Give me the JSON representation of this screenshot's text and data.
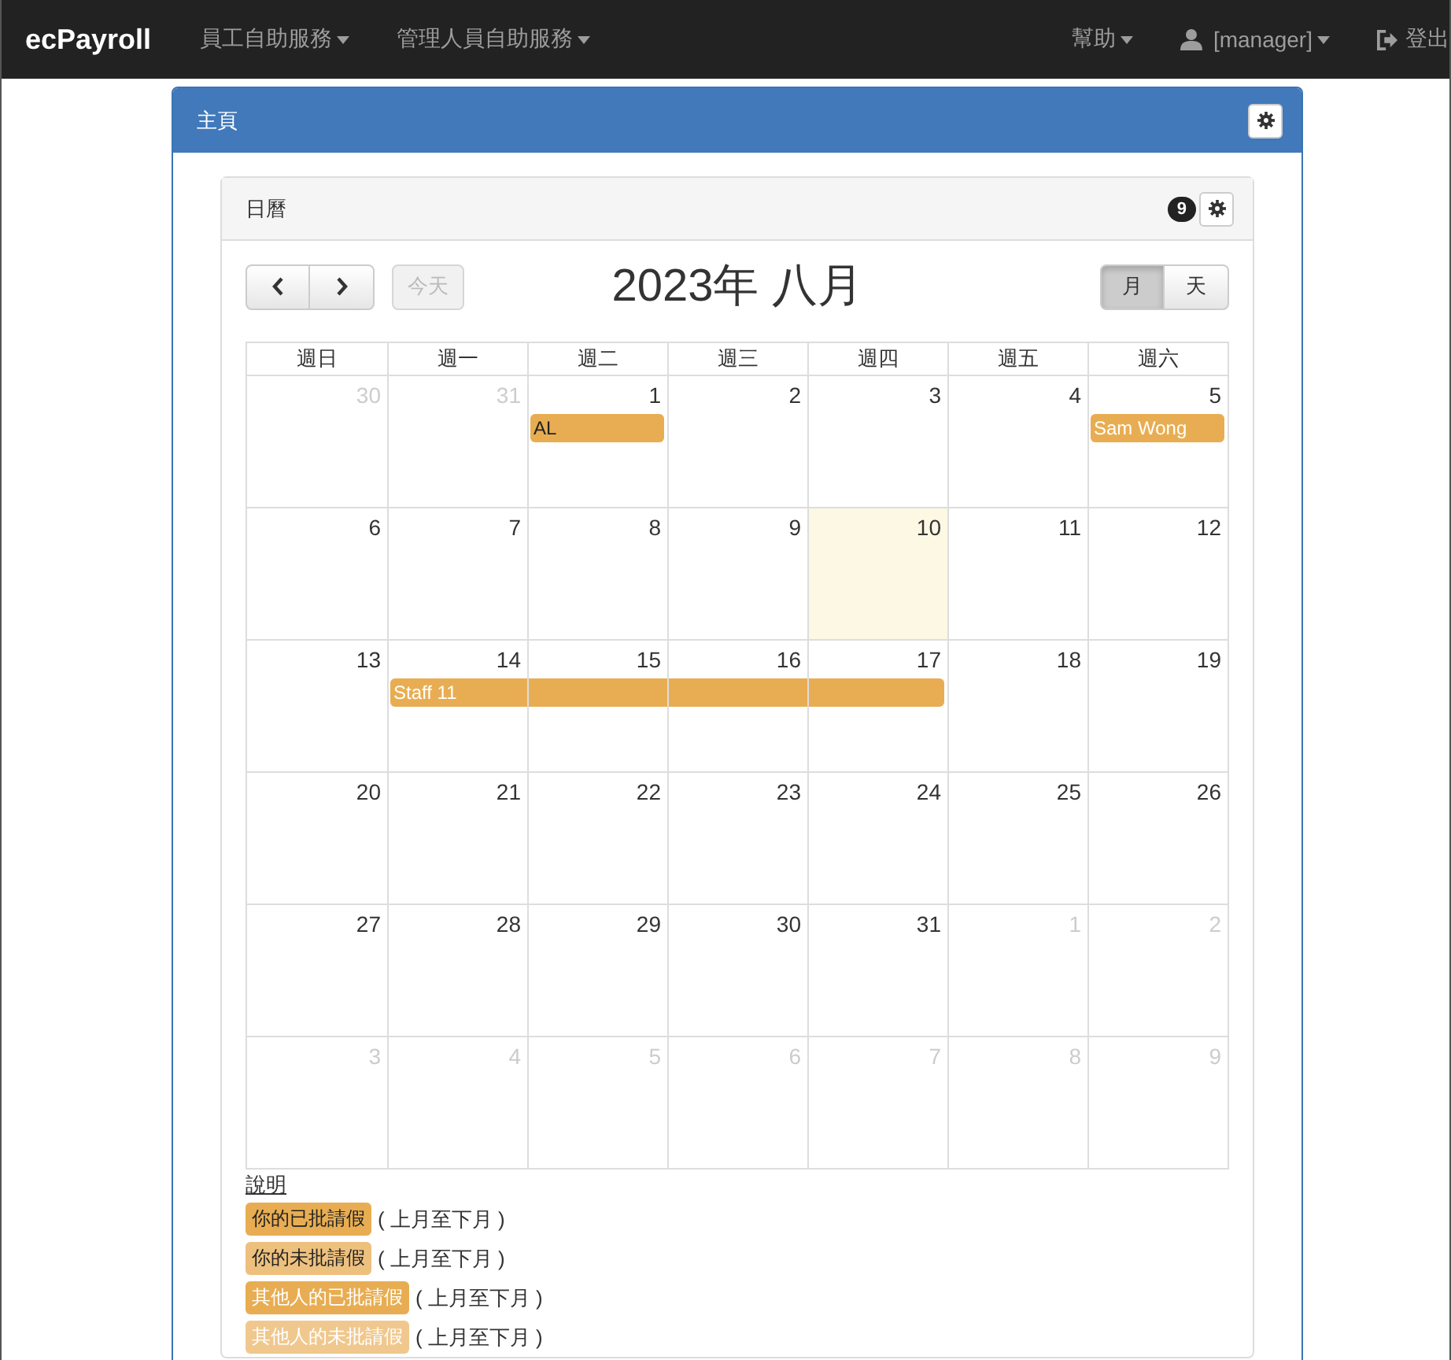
{
  "navbar": {
    "brand": "ecPayroll",
    "menus": [
      {
        "label": "員工自助服務"
      },
      {
        "label": "管理人員自助服務"
      }
    ],
    "right": [
      {
        "label": "幫助",
        "kind": "menu"
      },
      {
        "label": "[manager]",
        "kind": "user"
      },
      {
        "label": "登出",
        "kind": "logout"
      }
    ]
  },
  "panel": {
    "title": "主頁"
  },
  "calendar_panel": {
    "title": "日曆",
    "badge": "9",
    "toolbar": {
      "today_button": {
        "label": "今天",
        "disabled": true
      },
      "title": "2023年 八月",
      "views": [
        {
          "label": "月",
          "selected": true
        },
        {
          "label": "天",
          "selected": false
        }
      ]
    },
    "weekdays": [
      "週日",
      "週一",
      "週二",
      "週三",
      "週四",
      "週五",
      "週六"
    ],
    "weeks": [
      {
        "days": [
          {
            "day": "30",
            "other_month": true
          },
          {
            "day": "31",
            "other_month": true
          },
          {
            "day": "1",
            "other_month": false,
            "event": {
              "label": "AL",
              "kind": "own_approved"
            }
          },
          {
            "day": "2",
            "other_month": false
          },
          {
            "day": "3",
            "other_month": false
          },
          {
            "day": "4",
            "other_month": false
          },
          {
            "day": "5",
            "other_month": false,
            "event": {
              "label": "Sam Wong",
              "kind": "other_approved"
            }
          }
        ]
      },
      {
        "days": [
          {
            "day": "6",
            "other_month": false
          },
          {
            "day": "7",
            "other_month": false
          },
          {
            "day": "8",
            "other_month": false
          },
          {
            "day": "9",
            "other_month": false
          },
          {
            "day": "10",
            "other_month": false,
            "today": true
          },
          {
            "day": "11",
            "other_month": false
          },
          {
            "day": "12",
            "other_month": false
          }
        ]
      },
      {
        "days": [
          {
            "day": "13",
            "other_month": false
          },
          {
            "day": "14",
            "other_month": false,
            "event": {
              "label": "Staff 11",
              "kind": "other_approved"
            }
          },
          {
            "day": "15",
            "other_month": false,
            "event": {
              "continued": true
            }
          },
          {
            "day": "16",
            "other_month": false,
            "event": {
              "continued": true
            }
          },
          {
            "day": "17",
            "other_month": false,
            "event": {
              "continued": true
            }
          },
          {
            "day": "18",
            "other_month": false
          },
          {
            "day": "19",
            "other_month": false
          }
        ]
      },
      {
        "days": [
          {
            "day": "20",
            "other_month": false
          },
          {
            "day": "21",
            "other_month": false
          },
          {
            "day": "22",
            "other_month": false
          },
          {
            "day": "23",
            "other_month": false
          },
          {
            "day": "24",
            "other_month": false
          },
          {
            "day": "25",
            "other_month": false
          },
          {
            "day": "26",
            "other_month": false
          }
        ]
      },
      {
        "days": [
          {
            "day": "27",
            "other_month": false
          },
          {
            "day": "28",
            "other_month": false
          },
          {
            "day": "29",
            "other_month": false
          },
          {
            "day": "30",
            "other_month": false
          },
          {
            "day": "31",
            "other_month": false
          },
          {
            "day": "1",
            "other_month": true
          },
          {
            "day": "2",
            "other_month": true
          }
        ]
      },
      {
        "days": [
          {
            "day": "3",
            "other_month": true
          },
          {
            "day": "4",
            "other_month": true
          },
          {
            "day": "5",
            "other_month": true
          },
          {
            "day": "6",
            "other_month": true
          },
          {
            "day": "7",
            "other_month": true
          },
          {
            "day": "8",
            "other_month": true
          },
          {
            "day": "9",
            "other_month": true
          }
        ]
      }
    ],
    "legend": {
      "title": "說明",
      "items": [
        {
          "label": "你的已批請假",
          "kind": "own_approved",
          "note": "( 上月至下月 )"
        },
        {
          "label": "你的未批請假",
          "kind": "own_pending",
          "note": "( 上月至下月 )"
        },
        {
          "label": "其他人的已批請假",
          "kind": "other_approved",
          "note": "( 上月至下月 )"
        },
        {
          "label": "其他人的未批請假",
          "kind": "other_pending",
          "note": "( 上月至下月 )"
        }
      ]
    }
  }
}
